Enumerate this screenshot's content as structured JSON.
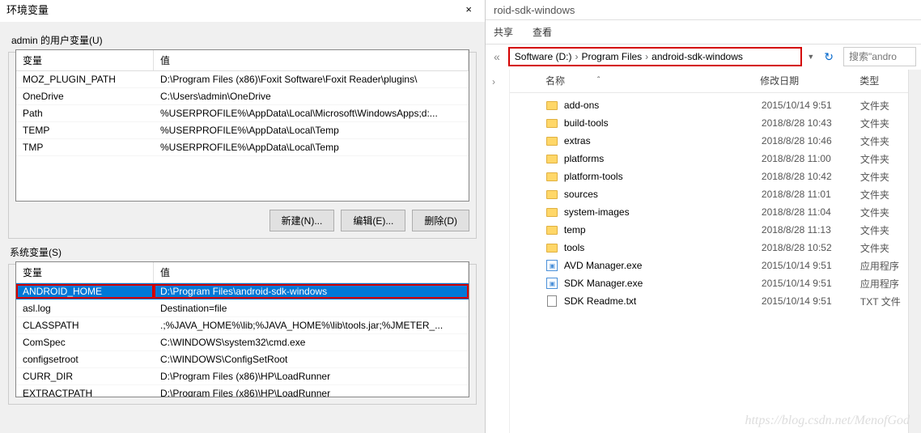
{
  "dialog": {
    "title": "环境变量",
    "user_section_label": "admin 的用户变量(U)",
    "sys_section_label": "系统变量(S)",
    "col_var": "变量",
    "col_val": "值",
    "btn_new": "新建(N)...",
    "btn_edit": "编辑(E)...",
    "btn_delete": "删除(D)",
    "user_vars": [
      {
        "name": "MOZ_PLUGIN_PATH",
        "value": "D:\\Program Files (x86)\\Foxit Software\\Foxit Reader\\plugins\\"
      },
      {
        "name": "OneDrive",
        "value": "C:\\Users\\admin\\OneDrive"
      },
      {
        "name": "Path",
        "value": "%USERPROFILE%\\AppData\\Local\\Microsoft\\WindowsApps;d:..."
      },
      {
        "name": "TEMP",
        "value": "%USERPROFILE%\\AppData\\Local\\Temp"
      },
      {
        "name": "TMP",
        "value": "%USERPROFILE%\\AppData\\Local\\Temp"
      }
    ],
    "sys_vars": [
      {
        "name": "ANDROID_HOME",
        "value": "D:\\Program Files\\android-sdk-windows",
        "selected": true
      },
      {
        "name": "asl.log",
        "value": "Destination=file"
      },
      {
        "name": "CLASSPATH",
        "value": ".;%JAVA_HOME%\\lib;%JAVA_HOME%\\lib\\tools.jar;%JMETER_..."
      },
      {
        "name": "ComSpec",
        "value": "C:\\WINDOWS\\system32\\cmd.exe"
      },
      {
        "name": "configsetroot",
        "value": "C:\\WINDOWS\\ConfigSetRoot"
      },
      {
        "name": "CURR_DIR",
        "value": "D:\\Program Files (x86)\\HP\\LoadRunner"
      },
      {
        "name": "EXTRACTPATH",
        "value": "D:\\Program Files (x86)\\HP\\LoadRunner"
      }
    ]
  },
  "explorer": {
    "window_title_suffix": "roid-sdk-windows",
    "tab_share": "共享",
    "tab_view": "查看",
    "breadcrumb": [
      "Software (D:)",
      "Program Files",
      "android-sdk-windows"
    ],
    "search_placeholder": "搜索\"andro",
    "col_name": "名称",
    "col_date": "修改日期",
    "col_type": "类型",
    "type_folder": "文件夹",
    "type_exe": "应用程序",
    "type_txt": "TXT 文件",
    "files": [
      {
        "name": "add-ons",
        "date": "2015/10/14 9:51",
        "kind": "folder"
      },
      {
        "name": "build-tools",
        "date": "2018/8/28 10:43",
        "kind": "folder"
      },
      {
        "name": "extras",
        "date": "2018/8/28 10:46",
        "kind": "folder"
      },
      {
        "name": "platforms",
        "date": "2018/8/28 11:00",
        "kind": "folder"
      },
      {
        "name": "platform-tools",
        "date": "2018/8/28 10:42",
        "kind": "folder"
      },
      {
        "name": "sources",
        "date": "2018/8/28 11:01",
        "kind": "folder"
      },
      {
        "name": "system-images",
        "date": "2018/8/28 11:04",
        "kind": "folder"
      },
      {
        "name": "temp",
        "date": "2018/8/28 11:13",
        "kind": "folder"
      },
      {
        "name": "tools",
        "date": "2018/8/28 10:52",
        "kind": "folder"
      },
      {
        "name": "AVD Manager.exe",
        "date": "2015/10/14 9:51",
        "kind": "exe"
      },
      {
        "name": "SDK Manager.exe",
        "date": "2015/10/14 9:51",
        "kind": "exe"
      },
      {
        "name": "SDK Readme.txt",
        "date": "2015/10/14 9:51",
        "kind": "txt"
      }
    ]
  },
  "watermark": "https://blog.csdn.net/MenofGod"
}
